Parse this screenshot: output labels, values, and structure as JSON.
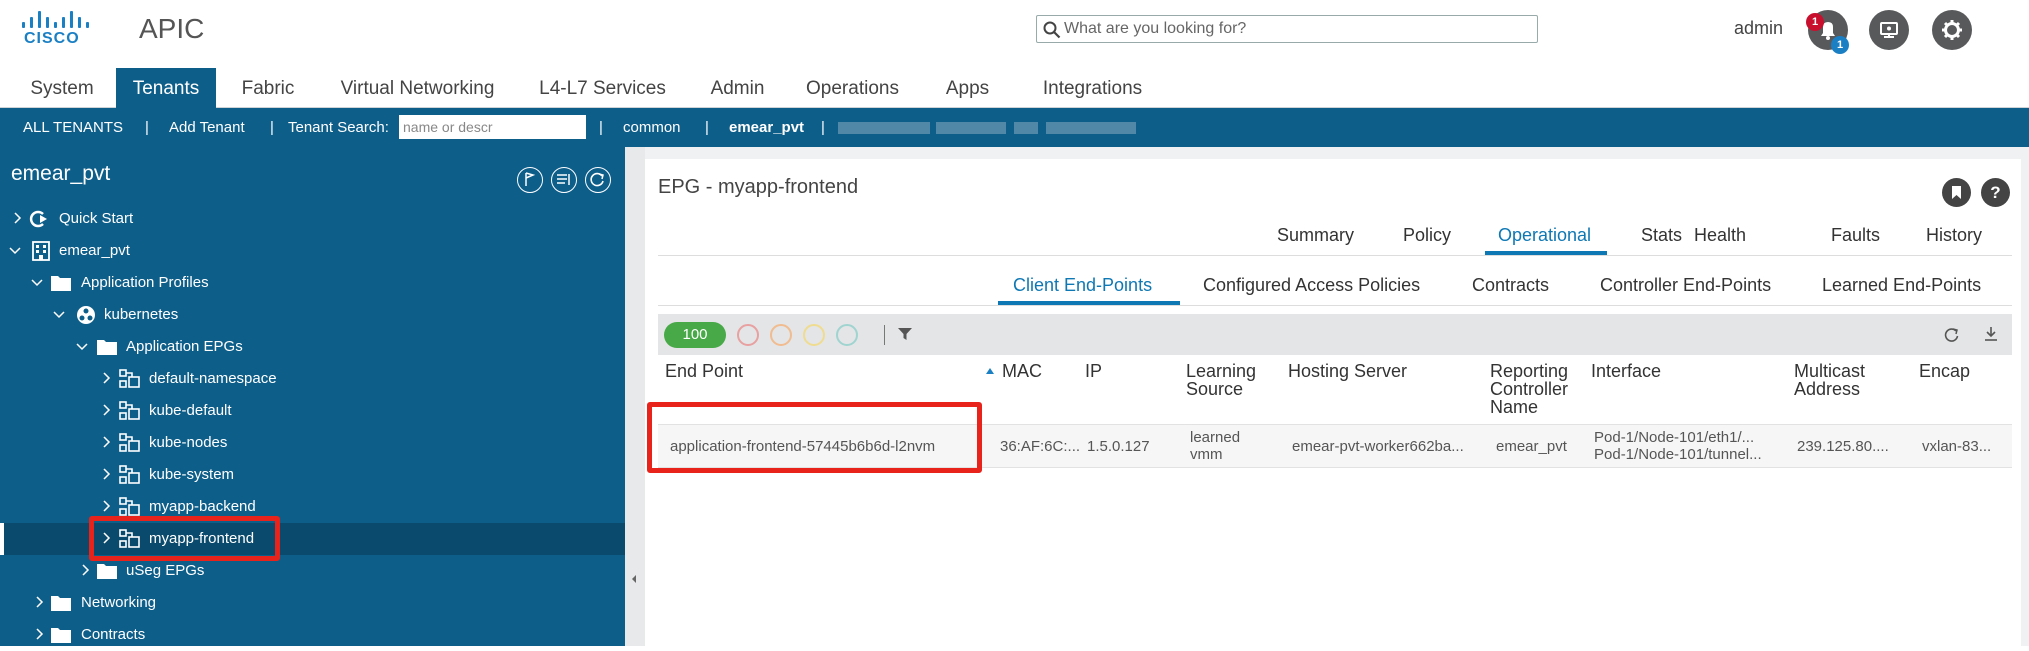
{
  "header": {
    "logo_text": "CISCO",
    "app_title": "APIC",
    "search_placeholder": "What are you looking for?",
    "username": "admin",
    "alert_badge_top": "1",
    "alert_badge_bottom": "1",
    "colors": {
      "brand_blue": "#1b7fc4",
      "nav_blue": "#0e5e8a",
      "highlight_red": "#e8231b",
      "active_tab": "#0e78b4"
    }
  },
  "nav_tabs": [
    "System",
    "Tenants",
    "Fabric",
    "Virtual Networking",
    "L4-L7 Services",
    "Admin",
    "Operations",
    "Apps",
    "Integrations"
  ],
  "subnav": {
    "all_tenants": "ALL TENANTS",
    "sep": "|",
    "add_tenant": "Add Tenant",
    "tenant_search_label": "Tenant Search:",
    "tenant_search_placeholder": "name or descr",
    "common": "common",
    "current": "emear_pvt"
  },
  "sidebar": {
    "title": "emear_pvt",
    "tree": [
      {
        "label": "Quick Start",
        "icon": "quick-start-icon"
      },
      {
        "label": "emear_pvt",
        "icon": "tenant-grid-icon"
      },
      {
        "label": "Application Profiles",
        "icon": "folder-icon"
      },
      {
        "label": "kubernetes",
        "icon": "app-profile-icon"
      },
      {
        "label": "Application EPGs",
        "icon": "folder-icon"
      },
      {
        "label": "default-namespace",
        "icon": "epg-icon"
      },
      {
        "label": "kube-default",
        "icon": "epg-icon"
      },
      {
        "label": "kube-nodes",
        "icon": "epg-icon"
      },
      {
        "label": "kube-system",
        "icon": "epg-icon"
      },
      {
        "label": "myapp-backend",
        "icon": "epg-icon"
      },
      {
        "label": "myapp-frontend",
        "icon": "epg-icon"
      },
      {
        "label": "uSeg EPGs",
        "icon": "folder-icon"
      },
      {
        "label": "Networking",
        "icon": "folder-icon"
      },
      {
        "label": "Contracts",
        "icon": "folder-icon"
      }
    ]
  },
  "main": {
    "title": "EPG - myapp-frontend",
    "tabs": [
      "Summary",
      "Policy",
      "Operational",
      "Stats",
      "Health",
      "Faults",
      "History"
    ],
    "active_tab": "Operational",
    "subtabs": [
      "Client End-Points",
      "Configured Access Policies",
      "Contracts",
      "Controller End-Points",
      "Learned End-Points"
    ],
    "active_subtab": "Client End-Points",
    "page_size": "100",
    "columns": [
      "End Point",
      "MAC",
      "IP",
      "Learning\nSource",
      "Hosting Server",
      "Reporting\nController\nName",
      "Interface",
      "Multicast\nAddress",
      "Encap"
    ],
    "rows": [
      {
        "end_point": "application-frontend-57445b6b6d-l2nvm",
        "mac": "36:AF:6C:...",
        "ip": "1.5.0.127",
        "learning_source_1": "learned",
        "learning_source_2": "vmm",
        "hosting_server": "emear-pvt-worker662ba...",
        "reporting_controller": "emear_pvt",
        "interface_1": "Pod-1/Node-101/eth1/...",
        "interface_2": "Pod-1/Node-101/tunnel...",
        "multicast": "239.125.80....",
        "encap": "vxlan-83..."
      }
    ]
  }
}
